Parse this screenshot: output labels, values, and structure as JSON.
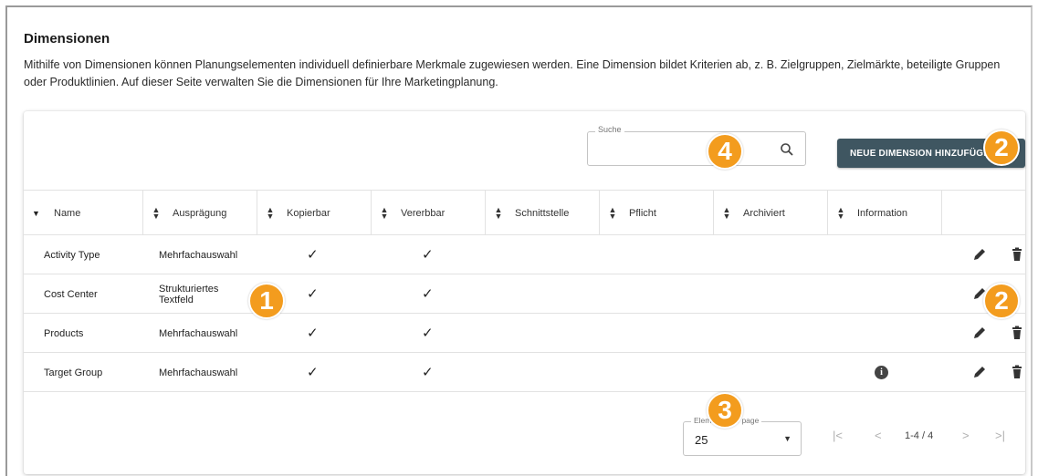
{
  "page": {
    "title": "Dimensionen",
    "description": "Mithilfe von Dimensionen können Planungselementen individuell definierbare Merkmale zugewiesen werden. Eine Dimension bildet Kriterien ab, z. B. Zielgruppen, Zielmärkte, beteiligte Gruppen oder Produktlinien. Auf dieser Seite verwalten Sie die Dimensionen für Ihre Marketingplanung."
  },
  "toolbar": {
    "search_label": "Suche",
    "search_value": "",
    "add_button": "NEUE DIMENSION HINZUFÜGEN"
  },
  "table": {
    "columns": [
      "Name",
      "Ausprägung",
      "Kopierbar",
      "Vererbbar",
      "Schnittstelle",
      "Pflicht",
      "Archiviert",
      "Information"
    ],
    "rows": [
      {
        "name": "Activity Type",
        "auspraegung": "Mehrfachauswahl",
        "kopierbar": "✓",
        "vererbbar": "✓",
        "info": false
      },
      {
        "name": "Cost Center",
        "auspraegung": "Strukturiertes Textfeld",
        "kopierbar": "✓",
        "vererbbar": "✓",
        "info": false
      },
      {
        "name": "Products",
        "auspraegung": "Mehrfachauswahl",
        "kopierbar": "✓",
        "vererbbar": "✓",
        "info": false
      },
      {
        "name": "Target Group",
        "auspraegung": "Mehrfachauswahl",
        "kopierbar": "✓",
        "vererbbar": "✓",
        "info": true
      }
    ],
    "info_glyph": "i"
  },
  "pagination": {
    "rows_per_page_label": "Elements per page",
    "rows_per_page": "25",
    "range": "1-4 / 4",
    "first": "|<",
    "prev": "<",
    "next": ">",
    "last": ">|"
  },
  "markers": {
    "m1": "1",
    "m2a": "2",
    "m2b": "2",
    "m3": "3",
    "m4": "4"
  },
  "colors": {
    "button_bg": "#3f5661",
    "marker": "#f39c1e"
  }
}
